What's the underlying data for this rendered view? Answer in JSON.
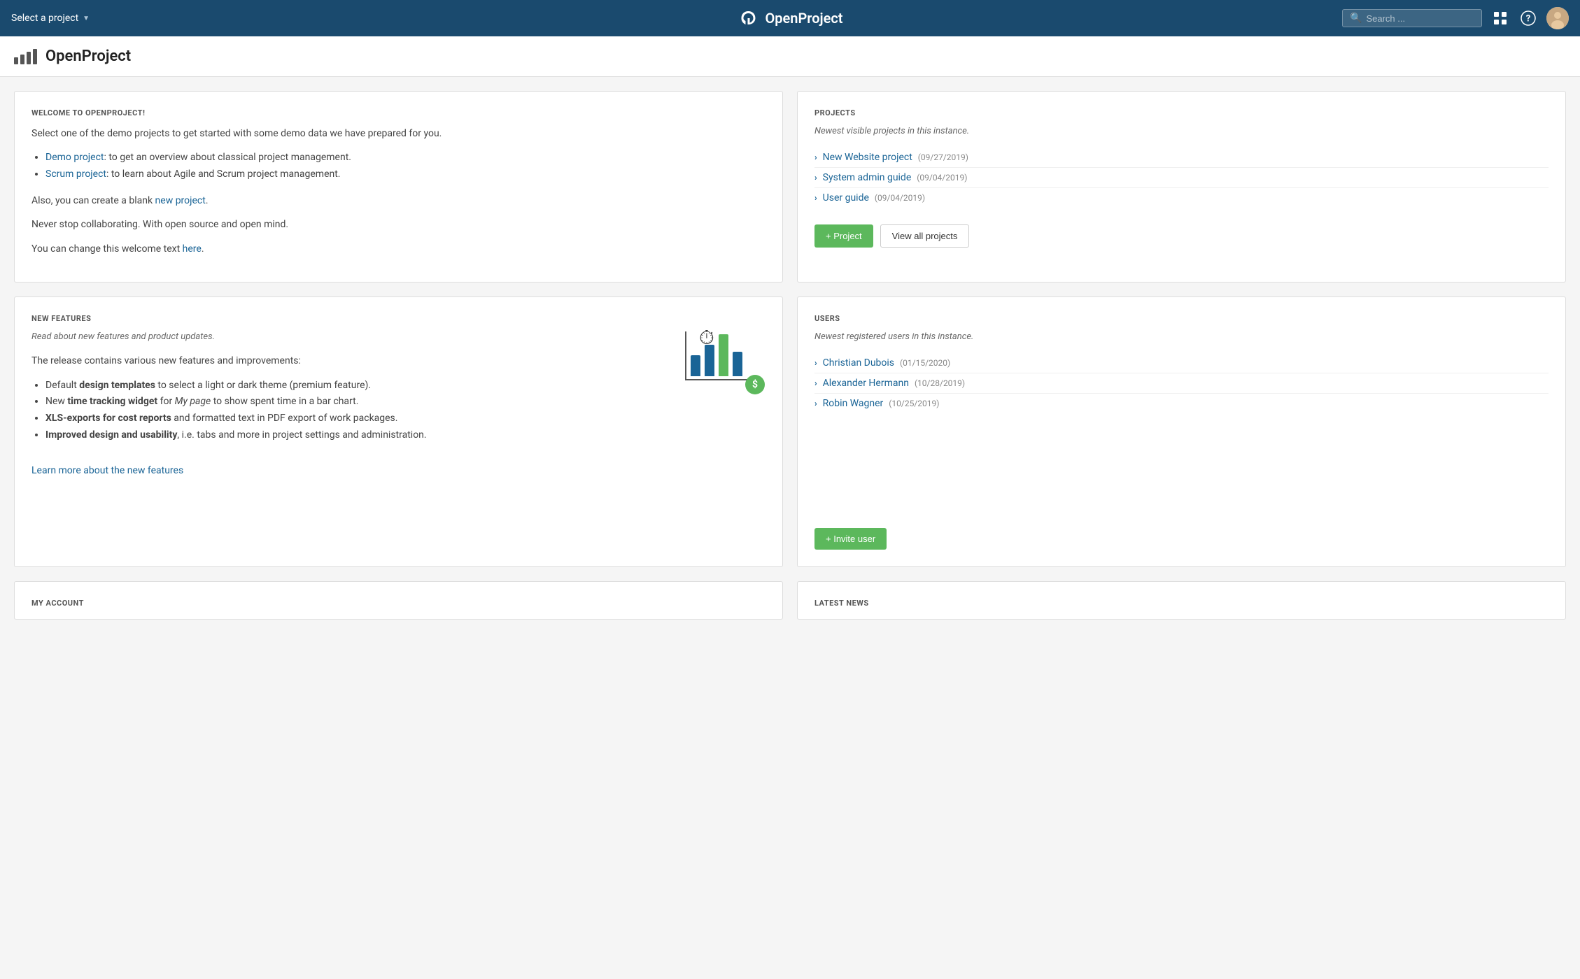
{
  "header": {
    "select_project_label": "Select a project",
    "logo_text": "OpenProject",
    "search_placeholder": "Search ...",
    "grid_icon": "⊞",
    "help_icon": "?",
    "avatar_emoji": "👤"
  },
  "page": {
    "title": "OpenProject"
  },
  "welcome_card": {
    "title": "WELCOME TO OPENPROJECT!",
    "intro": "Select one of the demo projects to get started with some demo data we have prepared for you.",
    "items": [
      {
        "link_text": "Demo project",
        "rest": ": to get an overview about classical project management."
      },
      {
        "link_text": "Scrum project",
        "rest": ": to learn about Agile and Scrum project management."
      }
    ],
    "blank_project_prefix": "Also, you can create a blank ",
    "blank_project_link": "new project",
    "blank_project_suffix": ".",
    "collab_text": "Never stop collaborating. With open source and open mind.",
    "change_text_prefix": "You can change this welcome text ",
    "change_text_link": "here",
    "change_text_suffix": "."
  },
  "projects_card": {
    "title": "PROJECTS",
    "subtitle": "Newest visible projects in this instance.",
    "projects": [
      {
        "name": "New Website project",
        "date": "(09/27/2019)"
      },
      {
        "name": "System admin guide",
        "date": "(09/04/2019)"
      },
      {
        "name": "User guide",
        "date": "(09/04/2019)"
      }
    ],
    "add_button": "+ Project",
    "view_all_button": "View all projects"
  },
  "new_features_card": {
    "title": "NEW FEATURES",
    "subtitle": "Read about new features and product updates.",
    "intro": "The release contains various new features and improvements:",
    "items": [
      {
        "bold": "design templates",
        "prefix": "Default ",
        "rest": " to select a light or dark theme (premium feature)."
      },
      {
        "bold": "time tracking widget",
        "prefix": "New ",
        "italic_text": "My page",
        "rest_before": " for ",
        "rest": " to show spent time in a bar chart."
      },
      {
        "bold": "XLS-exports for cost reports",
        "prefix": "",
        "rest": " and formatted text in PDF export of work packages."
      },
      {
        "bold": "Improved design and usability",
        "prefix": "",
        "rest": ", i.e. tabs and more in project settings and administration."
      }
    ],
    "learn_more": "Learn more about the new features"
  },
  "users_card": {
    "title": "USERS",
    "subtitle": "Newest registered users in this instance.",
    "users": [
      {
        "name": "Christian Dubois",
        "date": "(01/15/2020)"
      },
      {
        "name": "Alexander Hermann",
        "date": "(10/28/2019)"
      },
      {
        "name": "Robin Wagner",
        "date": "(10/25/2019)"
      }
    ],
    "invite_button": "+ Invite user"
  },
  "bottom_left": {
    "title": "MY ACCOUNT"
  },
  "bottom_right": {
    "title": "LATEST NEWS"
  }
}
